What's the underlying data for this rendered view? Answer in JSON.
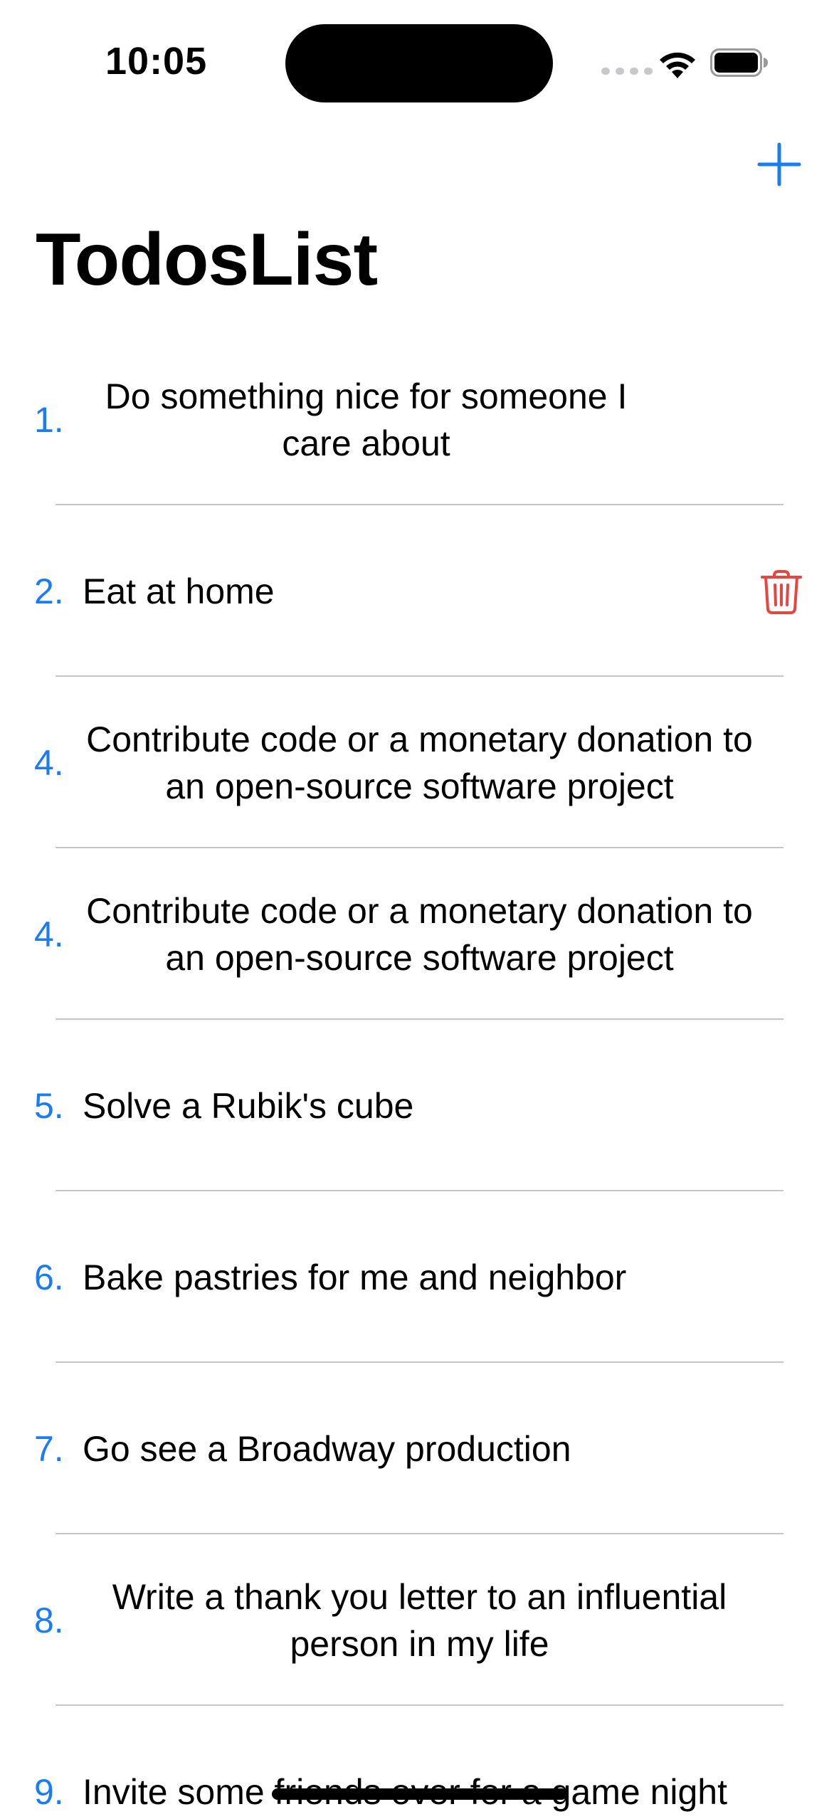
{
  "status_bar": {
    "time": "10:05",
    "wifi_icon": "wifi-icon",
    "battery_icon": "battery-icon"
  },
  "nav": {
    "add_icon": "plus-icon",
    "title": "TodosList",
    "accent_color": "#1a7cf2"
  },
  "todos": [
    {
      "number": "1.",
      "text": "Do something nice for someone I care about"
    },
    {
      "number": "2.",
      "text": "Eat at home",
      "action_icon": "trash-icon",
      "action_color": "#e8453c"
    },
    {
      "number": "4.",
      "text": "Contribute code or a monetary donation to an open-source software project"
    },
    {
      "number": "4.",
      "text": "Contribute code or a monetary donation to an open-source software project"
    },
    {
      "number": "5.",
      "text": "Solve a Rubik's cube"
    },
    {
      "number": "6.",
      "text": "Bake pastries for me and neighbor"
    },
    {
      "number": "7.",
      "text": "Go see a Broadway production"
    },
    {
      "number": "8.",
      "text": "Write a thank you letter to an influential person in my life"
    },
    {
      "number": "9.",
      "text": "Invite some friends over for a game night"
    }
  ]
}
